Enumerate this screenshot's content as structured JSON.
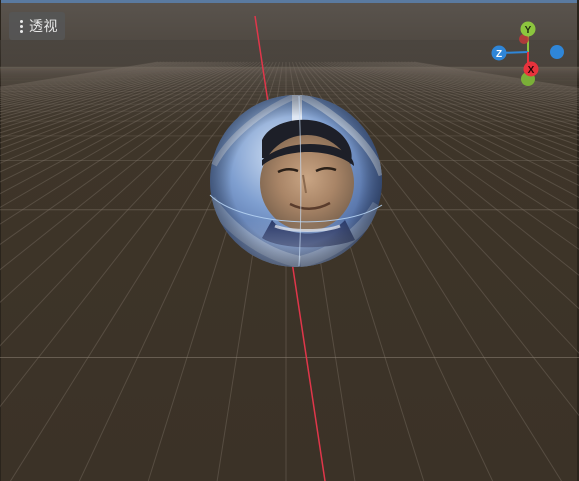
{
  "toolbar": {
    "view_mode_label": "透视",
    "menu_icon": "kebab-menu-icon"
  },
  "axis_gizmo": {
    "x_label": "X",
    "y_label": "Y",
    "z_label": "Z",
    "colors": {
      "x": "#e8323c",
      "y": "#8cc63e",
      "z": "#2f86d8"
    }
  },
  "scene": {
    "background_color": "#3d3429",
    "grid_color": "#8a7f72",
    "y_axis_line_color": "#e0364a",
    "object": "textured-sphere"
  }
}
